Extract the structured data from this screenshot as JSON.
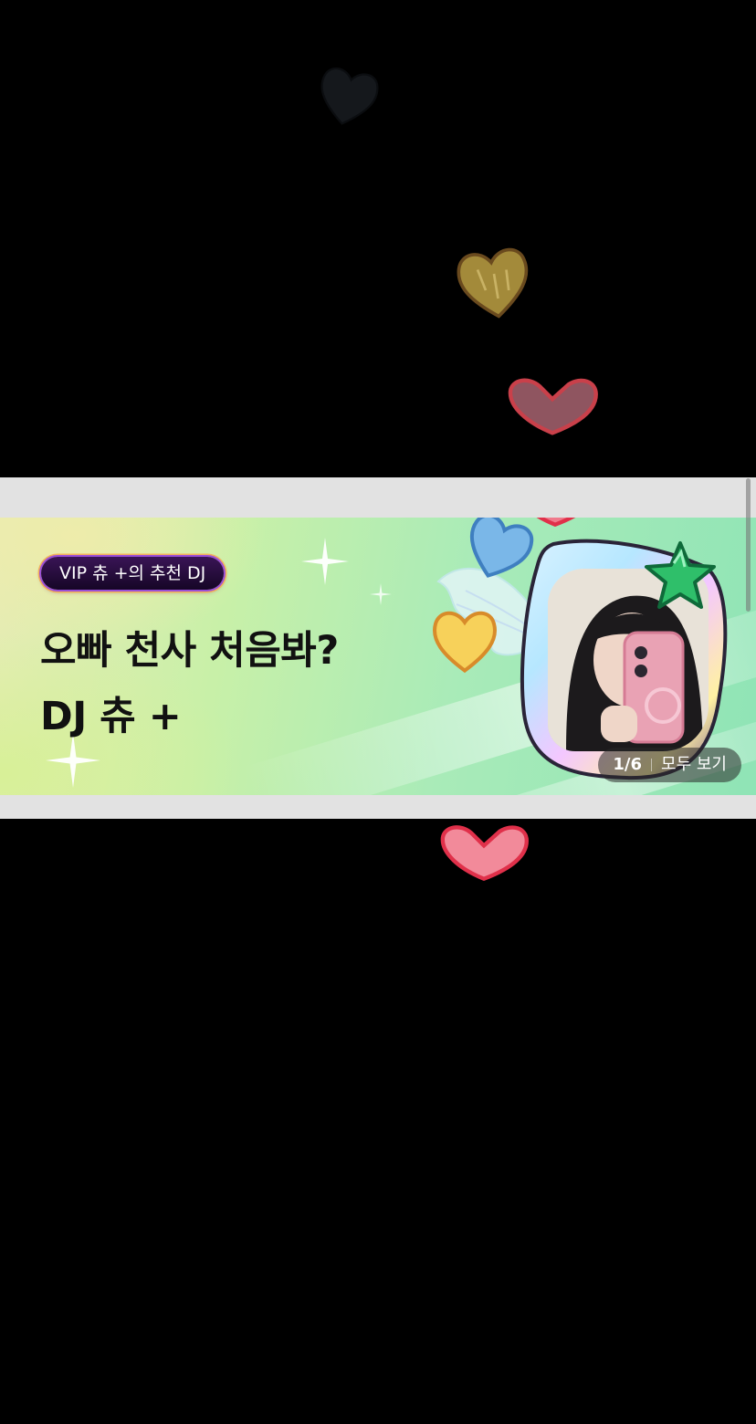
{
  "banner": {
    "badge": "VIP 츄 +의 추천 DJ",
    "title_line1": "오빠 천사 처음봐?",
    "title_line2": "DJ 츄 +",
    "pager": {
      "current": "1/6",
      "view_all": "모두 보기"
    }
  },
  "icons": {
    "floating_hearts": [
      "heart-icon-dark",
      "heart-icon-gold",
      "heart-icon-pink",
      "heart-icon-pink",
      "heart-icon-blue",
      "heart-icon-yellow",
      "heart-icon-pink"
    ],
    "star": "star-icon",
    "sparkle": "sparkle-icon"
  },
  "colors": {
    "background": "#000000",
    "strip": "#e2e2e2",
    "badge_bg": "#1f0a33",
    "badge_border": "#9a4fd8",
    "pager_bg": "#2a2a2a"
  }
}
